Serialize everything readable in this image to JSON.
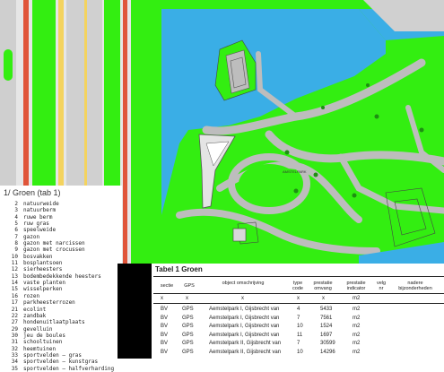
{
  "legend": {
    "title": "1/ Groen (tab 1)",
    "items": [
      {
        "num": "2",
        "label": "natuurweide"
      },
      {
        "num": "3",
        "label": "natuurberm"
      },
      {
        "num": "4",
        "label": "ruwe berm"
      },
      {
        "num": "5",
        "label": "ruw gras"
      },
      {
        "num": "6",
        "label": "speelweide"
      },
      {
        "num": "7",
        "label": "gazon"
      },
      {
        "num": "8",
        "label": "gazon met narcissen"
      },
      {
        "num": "9",
        "label": "gazon met crocussen"
      },
      {
        "num": "10",
        "label": "bosvakken"
      },
      {
        "num": "11",
        "label": "bosplantsoen"
      },
      {
        "num": "12",
        "label": "sierheesters"
      },
      {
        "num": "13",
        "label": "bodembedekkende heesters"
      },
      {
        "num": "14",
        "label": "vaste planten"
      },
      {
        "num": "15",
        "label": "wisselperken"
      },
      {
        "num": "16",
        "label": "rozen"
      },
      {
        "num": "17",
        "label": "parkheesterrozen"
      },
      {
        "num": "21",
        "label": "ecolint"
      },
      {
        "num": "22",
        "label": "zandbak"
      },
      {
        "num": "27",
        "label": "hondenuitlaatplaats"
      },
      {
        "num": "29",
        "label": "gevelluin"
      },
      {
        "num": "30",
        "label": "jeu de boules"
      },
      {
        "num": "31",
        "label": "schooltuinen"
      },
      {
        "num": "32",
        "label": "heemtuinen"
      },
      {
        "num": "33",
        "label": "sportvelden — gras"
      },
      {
        "num": "34",
        "label": "sportvelden — kunstgras"
      },
      {
        "num": "35",
        "label": "sportvelden — halfverharding"
      }
    ]
  },
  "table": {
    "title": "Tabel   1   Groen",
    "headers": [
      "sectie",
      "GPS",
      "object omschrijving",
      "type code",
      "prestatie omvang",
      "prestatie indicator",
      "velg nr",
      "nadere bijzonderheden"
    ],
    "xrow": [
      "x",
      "x",
      "x",
      "x",
      "x",
      "m2"
    ],
    "rows": [
      {
        "sectie": "BV",
        "gps": "GPS",
        "object": "Aemstelpark I, Gijsbrecht van",
        "type": "4",
        "omvang": "5433",
        "indicator": "m2"
      },
      {
        "sectie": "BV",
        "gps": "GPS",
        "object": "Aemstelpark I, Gijsbrecht van",
        "type": "7",
        "omvang": "7561",
        "indicator": "m2"
      },
      {
        "sectie": "BV",
        "gps": "GPS",
        "object": "Aemstelpark I, Gijsbrecht van",
        "type": "10",
        "omvang": "1524",
        "indicator": "m2"
      },
      {
        "sectie": "BV",
        "gps": "GPS",
        "object": "Aemstelpark I, Gijsbrecht van",
        "type": "11",
        "omvang": "1697",
        "indicator": "m2"
      },
      {
        "sectie": "BV",
        "gps": "GPS",
        "object": "Aemstelpark II, Gijsbrecht van",
        "type": "7",
        "omvang": "30599",
        "indicator": "m2"
      },
      {
        "sectie": "BV",
        "gps": "GPS",
        "object": "Aemstelpark II, Gijsbrecht van",
        "type": "10",
        "omvang": "14296",
        "indicator": "m2"
      }
    ]
  },
  "map": {
    "street_label": "AMSTELPARK",
    "colors": {
      "grass": "#33ee11",
      "water": "#3aaee6",
      "path": "#bdbdbd",
      "road_red": "#e0553a",
      "building": "#d8d8d8"
    }
  }
}
